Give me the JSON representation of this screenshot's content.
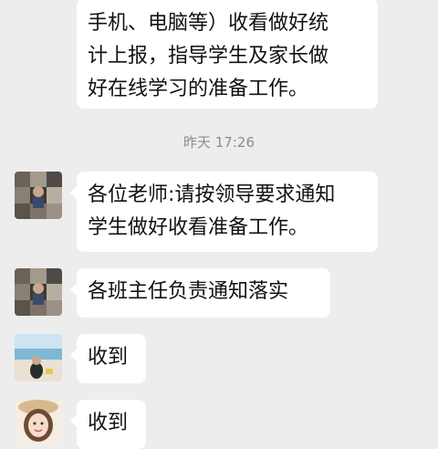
{
  "messages": [
    {
      "lines": [
        "手机、电脑等）收看做好统",
        "计上报，指导学生及家长做",
        "好在线学习的准备工作。"
      ]
    },
    {
      "lines": [
        "各位老师:请按领导要求通知",
        "学生做好收看准备工作。"
      ]
    },
    {
      "lines": [
        "各班主任负责通知落实"
      ]
    },
    {
      "lines": [
        "收到"
      ]
    },
    {
      "lines": [
        "收到"
      ]
    }
  ],
  "timestamp": "昨天 17:26",
  "avatars": [
    "collage-avatar-icon",
    "collage-avatar-icon",
    "beach-avatar-icon",
    "cartoon-girl-avatar-icon"
  ]
}
